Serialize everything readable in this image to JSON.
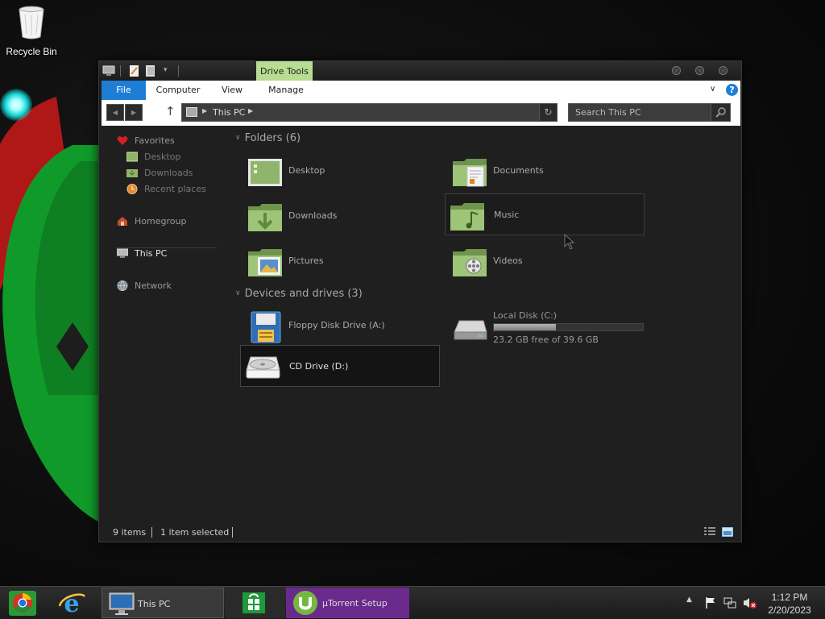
{
  "desktop": {
    "recycle_bin_label": "Recycle Bin"
  },
  "window": {
    "context_tab": "Drive Tools",
    "ribbon_tabs": [
      "File",
      "Computer",
      "View",
      "Manage"
    ],
    "address": {
      "crumb": "This PC"
    },
    "search": {
      "placeholder": "Search This PC"
    },
    "nav": {
      "favorites": "Favorites",
      "desktop": "Desktop",
      "downloads": "Downloads",
      "recent": "Recent places",
      "homegroup": "Homegroup",
      "this_pc": "This PC",
      "network": "Network"
    },
    "folders_header": "Folders (6)",
    "folders": [
      {
        "name": "Desktop",
        "icon": "desktop-folder-icon"
      },
      {
        "name": "Documents",
        "icon": "documents-folder-icon"
      },
      {
        "name": "Downloads",
        "icon": "downloads-folder-icon"
      },
      {
        "name": "Music",
        "icon": "music-folder-icon"
      },
      {
        "name": "Pictures",
        "icon": "pictures-folder-icon"
      },
      {
        "name": "Videos",
        "icon": "videos-folder-icon"
      }
    ],
    "devices_header": "Devices and drives (3)",
    "devices": {
      "floppy": "Floppy Disk Drive (A:)",
      "local_disk": {
        "name": "Local Disk (C:)",
        "free_text": "23.2 GB free of 39.6 GB",
        "used_fraction": 0.414
      },
      "cd": "CD Drive (D:)"
    },
    "status": {
      "items": "9 items",
      "selected": "1 item selected"
    }
  },
  "taskbar": {
    "this_pc_label": "This PC",
    "utorrent_label": "µTorrent Setup",
    "time": "1:12 PM",
    "date": "2/20/2023"
  },
  "colors": {
    "accent_blue": "#1e7ed6",
    "drive_tools_green": "#b7dc92",
    "folder_green": "#8fb56a",
    "utorrent_purple": "#6a2a8c"
  }
}
